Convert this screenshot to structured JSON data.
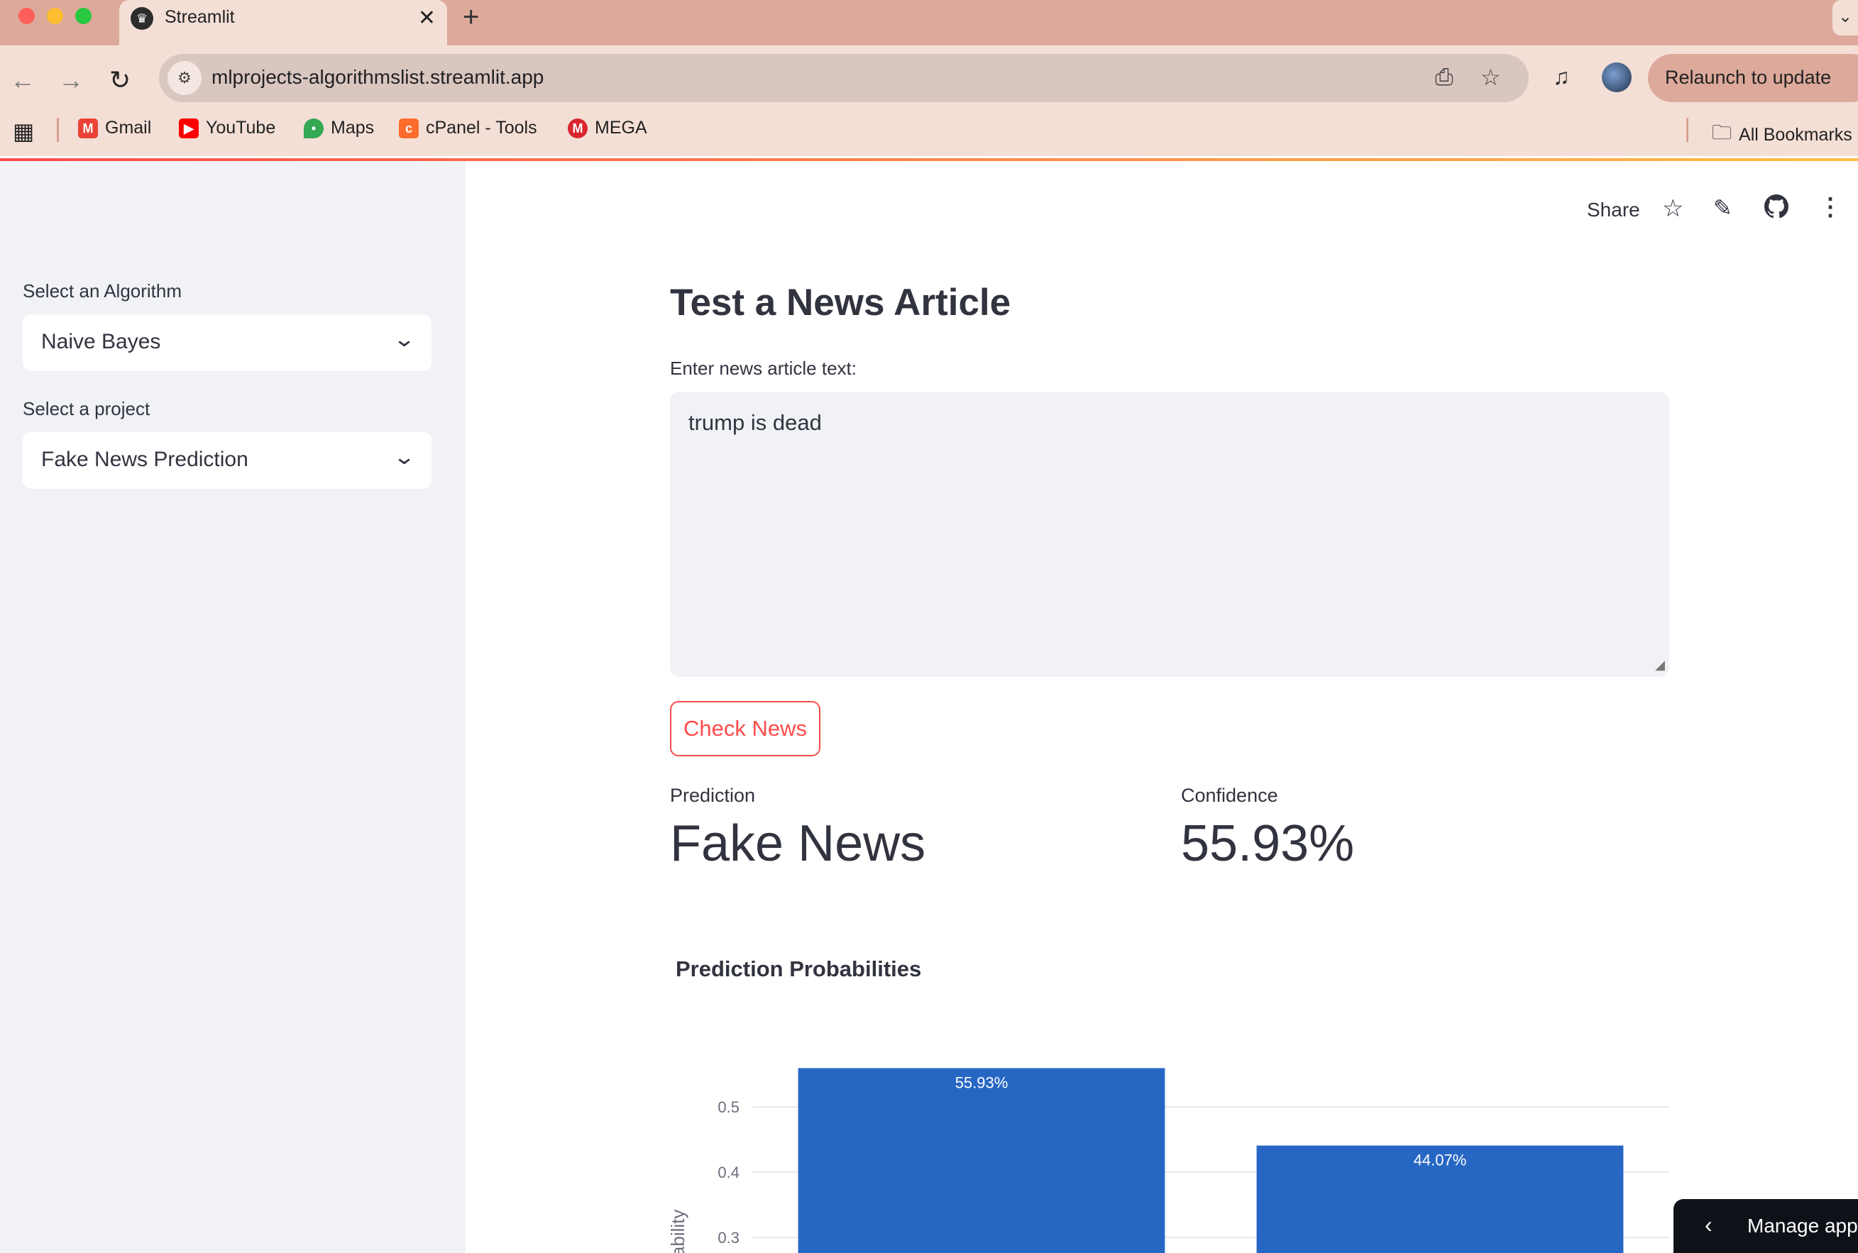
{
  "browser": {
    "tab_title": "Streamlit",
    "tab_close": "✕",
    "new_tab": "+",
    "url": "mlprojects-algorithmslist.streamlit.app",
    "relaunch_label": "Relaunch to update",
    "bookmarks": [
      {
        "label": "Gmail",
        "icon": "gmail-icon",
        "color": "#ea4335"
      },
      {
        "label": "YouTube",
        "icon": "youtube-icon",
        "color": "#ff0000"
      },
      {
        "label": "Maps",
        "icon": "maps-icon",
        "color": "#34a853"
      },
      {
        "label": "cPanel - Tools",
        "icon": "cpanel-icon",
        "color": "#ff6c2c"
      },
      {
        "label": "MEGA",
        "icon": "mega-icon",
        "color": "#d9272e"
      }
    ],
    "all_bookmarks": "All Bookmarks"
  },
  "sidebar": {
    "algorithm_label": "Select an Algorithm",
    "algorithm_value": "Naive Bayes",
    "project_label": "Select a project",
    "project_value": "Fake News Prediction"
  },
  "header": {
    "share_label": "Share"
  },
  "main": {
    "title": "Test a News Article",
    "input_label": "Enter news article text:",
    "input_value": "trump is dead",
    "check_button": "Check News",
    "prediction_label": "Prediction",
    "prediction_value": "Fake News",
    "confidence_label": "Confidence",
    "confidence_value": "55.93%"
  },
  "chart_data": {
    "type": "bar",
    "title": "Prediction Probabilities",
    "ylabel": "Probability",
    "values": [
      0.5593,
      0.4407
    ],
    "data_labels": [
      "55.93%",
      "44.07%"
    ],
    "yticks": [
      "0.5",
      "0.4",
      "0.3"
    ],
    "ylim": [
      0,
      0.6
    ],
    "grid": true,
    "bar_color": "#2767c4"
  },
  "footer": {
    "manage_app": "Manage app"
  },
  "colors": {
    "accent": "#ff4b4b",
    "sidebar_bg": "#f0f2f6",
    "text": "#31333f",
    "browser_frame": "#dca99b"
  }
}
